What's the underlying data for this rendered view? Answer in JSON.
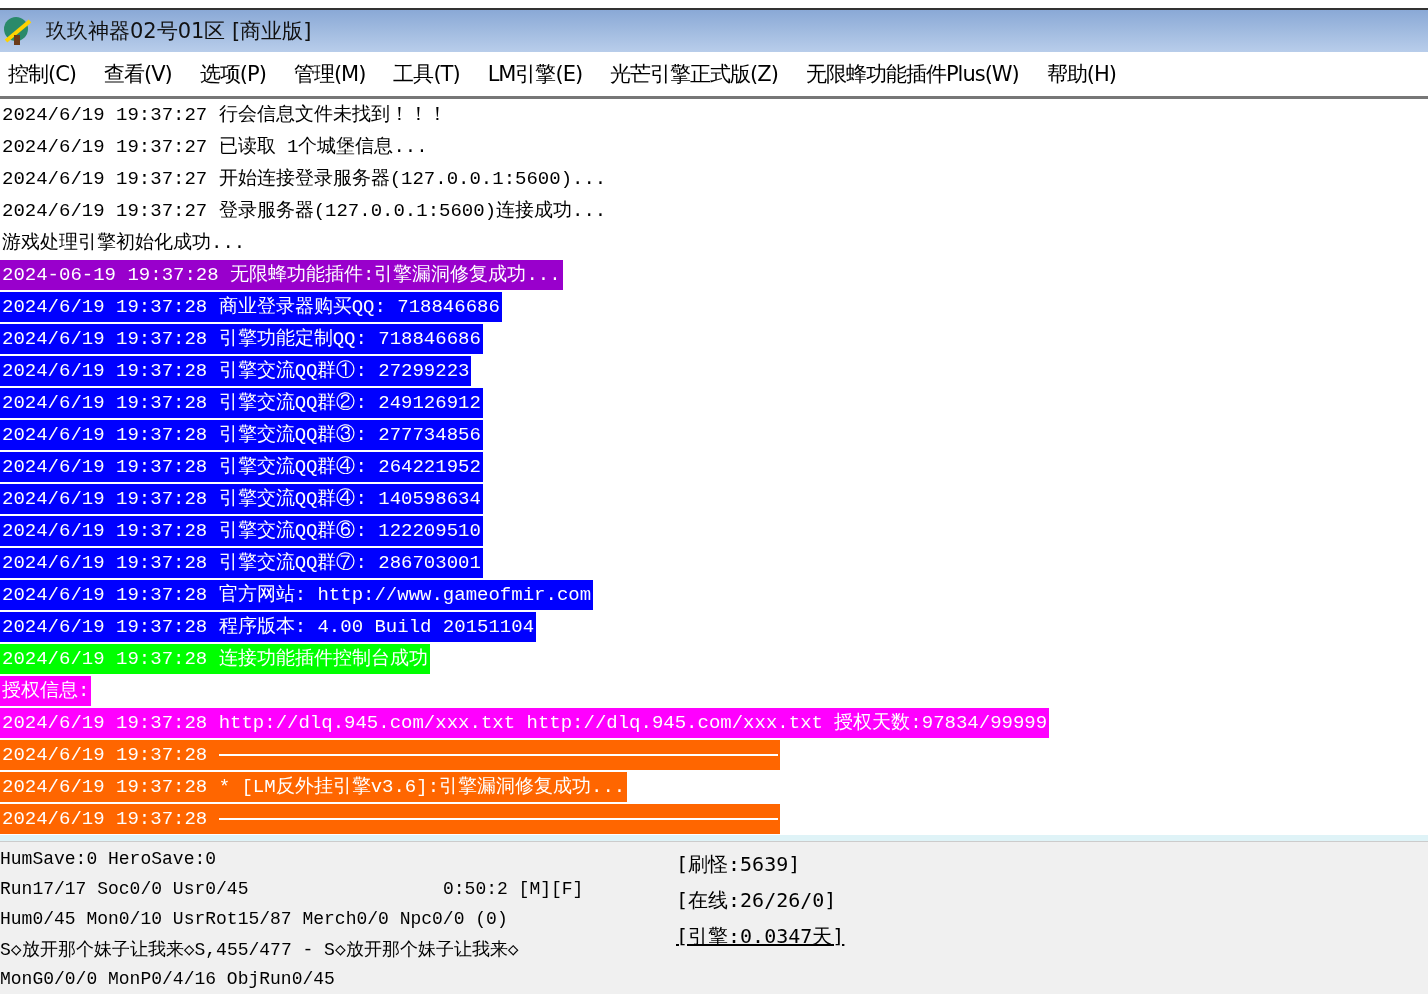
{
  "window": {
    "title": "玖玖神器02号01区 [商业版]"
  },
  "menu": [
    {
      "label": "控制(C)"
    },
    {
      "label": "查看(V)"
    },
    {
      "label": "选项(P)"
    },
    {
      "label": "管理(M)"
    },
    {
      "label": "工具(T)"
    },
    {
      "label": "LM引擎(E)"
    },
    {
      "label": "光芒引擎正式版(Z)"
    },
    {
      "label": "无限蜂功能插件Plus(W)"
    },
    {
      "label": "帮助(H)"
    }
  ],
  "log": [
    {
      "kind": "plain",
      "text": "2024/6/19 19:37:27 行会信息文件未找到！！！"
    },
    {
      "kind": "plain",
      "text": "2024/6/19 19:37:27 已读取 1个城堡信息..."
    },
    {
      "kind": "plain",
      "text": "2024/6/19 19:37:27 开始连接登录服务器(127.0.0.1:5600)..."
    },
    {
      "kind": "plain",
      "text": "2024/6/19 19:37:27 登录服务器(127.0.0.1:5600)连接成功..."
    },
    {
      "kind": "plain",
      "text": "游戏处理引擎初始化成功..."
    },
    {
      "kind": "highlight",
      "color": "#9900cc",
      "text": "2024-06-19 19:37:28 无限蜂功能插件:引擎漏洞修复成功..."
    },
    {
      "kind": "highlight",
      "color": "#0000ff",
      "text": "2024/6/19 19:37:28 商业登录器购买QQ: 718846686"
    },
    {
      "kind": "highlight",
      "color": "#0000ff",
      "text": "2024/6/19 19:37:28 引擎功能定制QQ: 718846686"
    },
    {
      "kind": "highlight",
      "color": "#0000ff",
      "text": "2024/6/19 19:37:28 引擎交流QQ群①: 27299223"
    },
    {
      "kind": "highlight",
      "color": "#0000ff",
      "text": "2024/6/19 19:37:28 引擎交流QQ群②: 249126912"
    },
    {
      "kind": "highlight",
      "color": "#0000ff",
      "text": "2024/6/19 19:37:28 引擎交流QQ群③: 277734856"
    },
    {
      "kind": "highlight",
      "color": "#0000ff",
      "text": "2024/6/19 19:37:28 引擎交流QQ群④: 264221952"
    },
    {
      "kind": "highlight",
      "color": "#0000ff",
      "text": "2024/6/19 19:37:28 引擎交流QQ群④: 140598634"
    },
    {
      "kind": "highlight",
      "color": "#0000ff",
      "text": "2024/6/19 19:37:28 引擎交流QQ群⑥: 122209510"
    },
    {
      "kind": "highlight",
      "color": "#0000ff",
      "text": "2024/6/19 19:37:28 引擎交流QQ群⑦: 286703001"
    },
    {
      "kind": "highlight",
      "color": "#0000ff",
      "text": "2024/6/19 19:37:28 官方网站: http://www.gameofmir.com"
    },
    {
      "kind": "highlight",
      "color": "#0000ff",
      "text": "2024/6/19 19:37:28 程序版本: 4.00 Build 20151104"
    },
    {
      "kind": "highlight",
      "color": "#00ff00",
      "text": "2024/6/19 19:37:28 连接功能插件控制台成功"
    },
    {
      "kind": "highlight",
      "color": "#ff00ff",
      "text": "授权信息:"
    },
    {
      "kind": "highlight",
      "color": "#ff00ff",
      "text": "2024/6/19 19:37:28 http://dlq.945.com/xxx.txt http://dlq.945.com/xxx.txt 授权天数:97834/99999"
    },
    {
      "kind": "rule",
      "color": "#ff6600",
      "text": "2024/6/19 19:37:28"
    },
    {
      "kind": "highlight",
      "color": "#ff6600",
      "text": "2024/6/19 19:37:28 * [LM反外挂引擎v3.6]:引擎漏洞修复成功..."
    },
    {
      "kind": "rule",
      "color": "#ff6600",
      "text": "2024/6/19 19:37:28"
    }
  ],
  "status": {
    "lines": [
      {
        "left": "HumSave:0 HeroSave:0"
      },
      {
        "left": "Run17/17 Soc0/0 Usr0/45",
        "right": "0:50:2 [M][F]"
      },
      {
        "left": "Hum0/45 Mon0/10 UsrRot15/87 Merch0/0 Npc0/0 (0)"
      },
      {
        "left": "S◇放开那个妹子让我来◇S,455/477 - S◇放开那个妹子让我来◇"
      },
      {
        "left": "MonG0/0/0 MonP0/4/16 ObjRun0/45"
      }
    ],
    "counters": [
      "[刷怪:5639]",
      "[在线:26/26/0]",
      "[引擎:0.0347天]"
    ]
  }
}
